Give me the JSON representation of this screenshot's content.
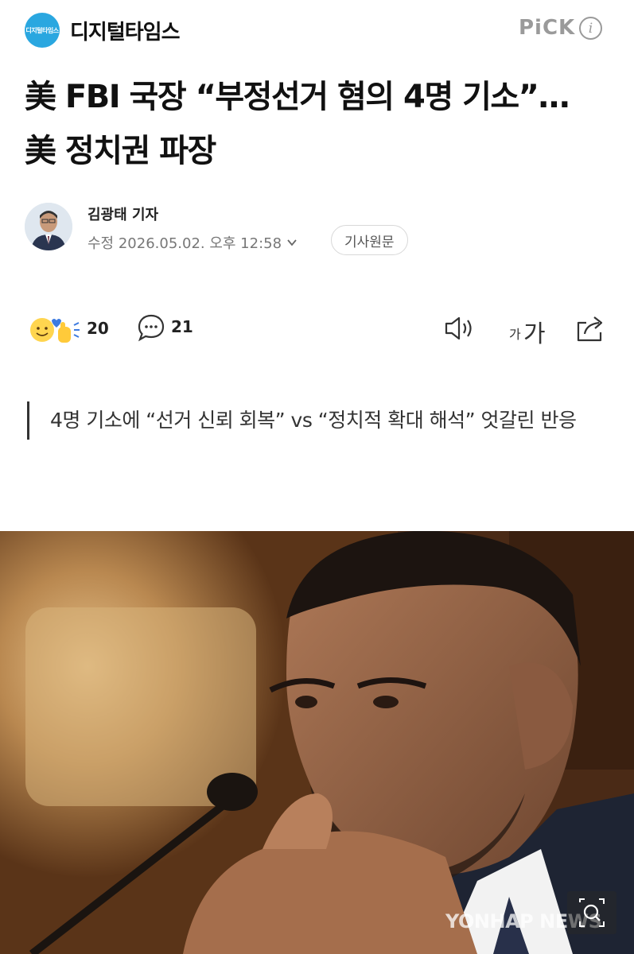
{
  "header": {
    "press_logo_text": "디지털타임스",
    "press_name": "디지털타임스",
    "pick_label": "PiCK",
    "info_glyph": "i"
  },
  "article": {
    "title": "美 FBI 국장 “부정선거 혐의 4명 기소”…美 정치권 파장",
    "reporter": "김광태 기자",
    "date": "수정 2026.05.02. 오후 12:58",
    "original_button": "기사원문",
    "summary": "4명 기소에 “선거 신뢰 회복” vs “정치적 확대 해석” 엇갈린 반응"
  },
  "actions": {
    "reaction_count": "20",
    "comment_count": "21",
    "font_small": "가",
    "font_large": "가"
  },
  "photo": {
    "watermark": "YONHAP NEWS"
  },
  "colors": {
    "logo_blue": "#2aa7e0",
    "pick_gray": "#9a9a9a",
    "text": "#111111"
  },
  "icons": [
    "info-icon",
    "chevron-down-icon",
    "reaction-emoji-icon",
    "comment-icon",
    "speaker-icon",
    "font-size-icon",
    "share-icon",
    "zoom-icon"
  ]
}
